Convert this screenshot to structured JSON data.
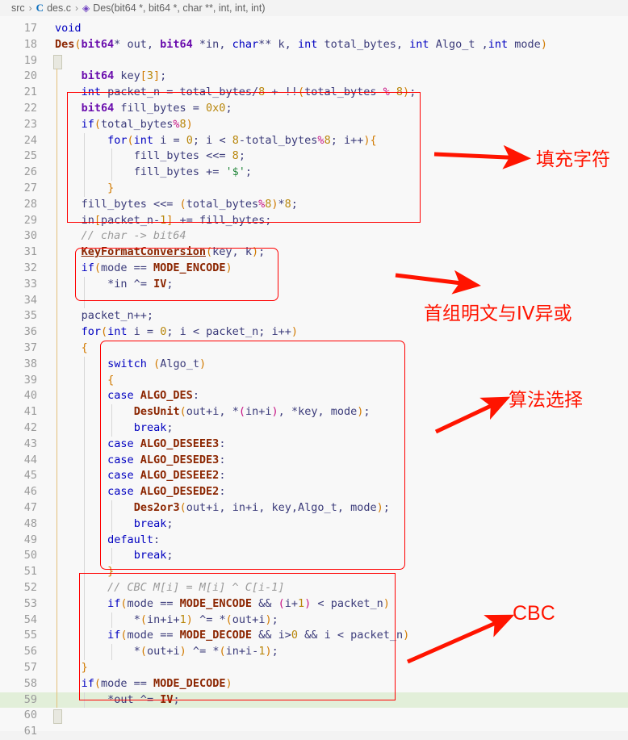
{
  "breadcrumb": {
    "root": "src",
    "file": "des.c",
    "file_icon": "c-file-icon",
    "symbol_icon": "symbol-method-icon",
    "symbol": "Des(bit64 *, bit64 *, char **, int, int, int)",
    "separator": "›"
  },
  "editor": {
    "language": "c",
    "first_line_number": 17,
    "last_line_number": 61,
    "highlighted_line": 59,
    "lines": [
      {
        "n": 17,
        "text": "void"
      },
      {
        "n": 18,
        "text": "Des(bit64* out, bit64 *in, char** k, int total_bytes, int Algo_t ,int mode)"
      },
      {
        "n": 19,
        "text": "{"
      },
      {
        "n": 20,
        "text": "    bit64 key[3];"
      },
      {
        "n": 21,
        "text": "    int packet_n = total_bytes/8 + !!(total_bytes % 8);"
      },
      {
        "n": 22,
        "text": "    bit64 fill_bytes = 0x0;"
      },
      {
        "n": 23,
        "text": "    if(total_bytes%8)"
      },
      {
        "n": 24,
        "text": "        for(int i = 0; i < 8-total_bytes%8; i++){"
      },
      {
        "n": 25,
        "text": "            fill_bytes <<= 8;"
      },
      {
        "n": 26,
        "text": "            fill_bytes += '$';"
      },
      {
        "n": 27,
        "text": "        }"
      },
      {
        "n": 28,
        "text": "    fill_bytes <<= (total_bytes%8)*8;"
      },
      {
        "n": 29,
        "text": "    in[packet_n-1] += fill_bytes;"
      },
      {
        "n": 30,
        "text": "    // char -> bit64"
      },
      {
        "n": 31,
        "text": "    KeyFormatConversion(key, k);"
      },
      {
        "n": 32,
        "text": "    if(mode == MODE_ENCODE)"
      },
      {
        "n": 33,
        "text": "        *in ^= IV;"
      },
      {
        "n": 34,
        "text": ""
      },
      {
        "n": 35,
        "text": "    packet_n++;"
      },
      {
        "n": 36,
        "text": "    for(int i = 0; i < packet_n; i++)"
      },
      {
        "n": 37,
        "text": "    {"
      },
      {
        "n": 38,
        "text": "        switch (Algo_t)"
      },
      {
        "n": 39,
        "text": "        {"
      },
      {
        "n": 40,
        "text": "        case ALGO_DES:"
      },
      {
        "n": 41,
        "text": "            DesUnit(out+i, *(in+i), *key, mode);"
      },
      {
        "n": 42,
        "text": "            break;"
      },
      {
        "n": 43,
        "text": "        case ALGO_DESEEE3:"
      },
      {
        "n": 44,
        "text": "        case ALGO_DESEDE3:"
      },
      {
        "n": 45,
        "text": "        case ALGO_DESEEE2:"
      },
      {
        "n": 46,
        "text": "        case ALGO_DESEDE2:"
      },
      {
        "n": 47,
        "text": "            Des2or3(out+i, in+i, key,Algo_t, mode);"
      },
      {
        "n": 48,
        "text": "            break;"
      },
      {
        "n": 49,
        "text": "        default:"
      },
      {
        "n": 50,
        "text": "            break;"
      },
      {
        "n": 51,
        "text": "        }"
      },
      {
        "n": 52,
        "text": "        // CBC M[i] = M[i] ^ C[i-1]"
      },
      {
        "n": 53,
        "text": "        if(mode == MODE_ENCODE && (i+1) < packet_n)"
      },
      {
        "n": 54,
        "text": "            *(in+i+1) ^= *(out+i);"
      },
      {
        "n": 55,
        "text": "        if(mode == MODE_DECODE && i>0 && i < packet_n)"
      },
      {
        "n": 56,
        "text": "            *(out+i) ^= *(in+i-1);"
      },
      {
        "n": 57,
        "text": "    }"
      },
      {
        "n": 58,
        "text": "    if(mode == MODE_DECODE)"
      },
      {
        "n": 59,
        "text": "        *out ^= IV;"
      },
      {
        "n": 60,
        "text": "}"
      },
      {
        "n": 61,
        "text": ""
      }
    ]
  },
  "annotations": {
    "color": "#ff1400",
    "items": [
      {
        "label": "填充字符",
        "lines": "22-29",
        "arrow": "right"
      },
      {
        "label": "首组明文与IV异或",
        "lines": "32-34",
        "arrow": "right"
      },
      {
        "label": "算法选择",
        "lines": "38-51",
        "arrow": "up-right"
      },
      {
        "label": "CBC",
        "lines": "52-59",
        "arrow": "up-right"
      }
    ]
  }
}
